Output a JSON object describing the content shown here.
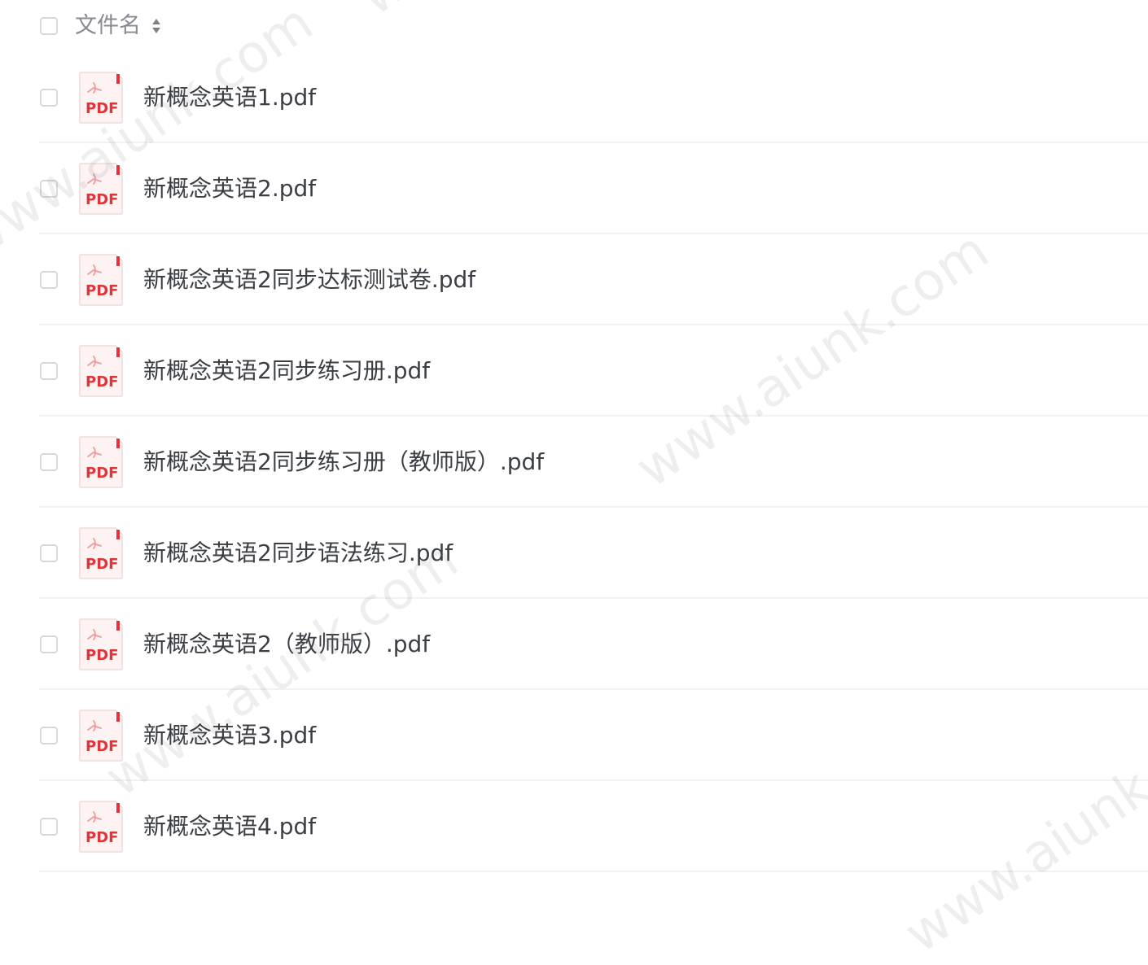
{
  "header": {
    "column_label": "文件名",
    "sort_icon": "sort-icon"
  },
  "file_icon": {
    "icon": "pdf-file-icon",
    "badge_text": "PDF",
    "accent_color": "#e0343b"
  },
  "files": [
    {
      "name": "新概念英语1.pdf"
    },
    {
      "name": "新概念英语2.pdf"
    },
    {
      "name": "新概念英语2同步达标测试卷.pdf"
    },
    {
      "name": "新概念英语2同步练习册.pdf"
    },
    {
      "name": "新概念英语2同步练习册（教师版）.pdf"
    },
    {
      "name": "新概念英语2同步语法练习.pdf"
    },
    {
      "name": "新概念英语2（教师版）.pdf"
    },
    {
      "name": "新概念英语3.pdf"
    },
    {
      "name": "新概念英语4.pdf"
    }
  ],
  "watermark": {
    "text": "www.aiunk.com"
  }
}
